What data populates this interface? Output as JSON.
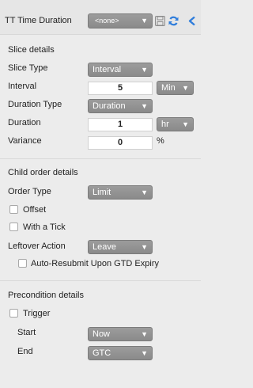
{
  "header": {
    "label": "TT Time Duration",
    "select_value": "<none>",
    "save_icon": "save-icon",
    "refresh_icon": "refresh-icon",
    "back_icon": "chevron-left-icon",
    "accent_color": "#2f7ddb"
  },
  "slice": {
    "title": "Slice details",
    "slice_type_label": "Slice Type",
    "slice_type_value": "Interval",
    "interval_label": "Interval",
    "interval_value": "5",
    "interval_unit": "Min",
    "duration_type_label": "Duration Type",
    "duration_type_value": "Duration",
    "duration_label": "Duration",
    "duration_value": "1",
    "duration_unit": "hr",
    "variance_label": "Variance",
    "variance_value": "0",
    "variance_unit": "%"
  },
  "child": {
    "title": "Child order details",
    "order_type_label": "Order Type",
    "order_type_value": "Limit",
    "offset_label": "Offset",
    "with_tick_label": "With a Tick",
    "leftover_label": "Leftover Action",
    "leftover_value": "Leave",
    "auto_resubmit_label": "Auto-Resubmit Upon GTD Expiry"
  },
  "precondition": {
    "title": "Precondition details",
    "trigger_label": "Trigger",
    "start_label": "Start",
    "start_value": "Now",
    "end_label": "End",
    "end_value": "GTC"
  }
}
